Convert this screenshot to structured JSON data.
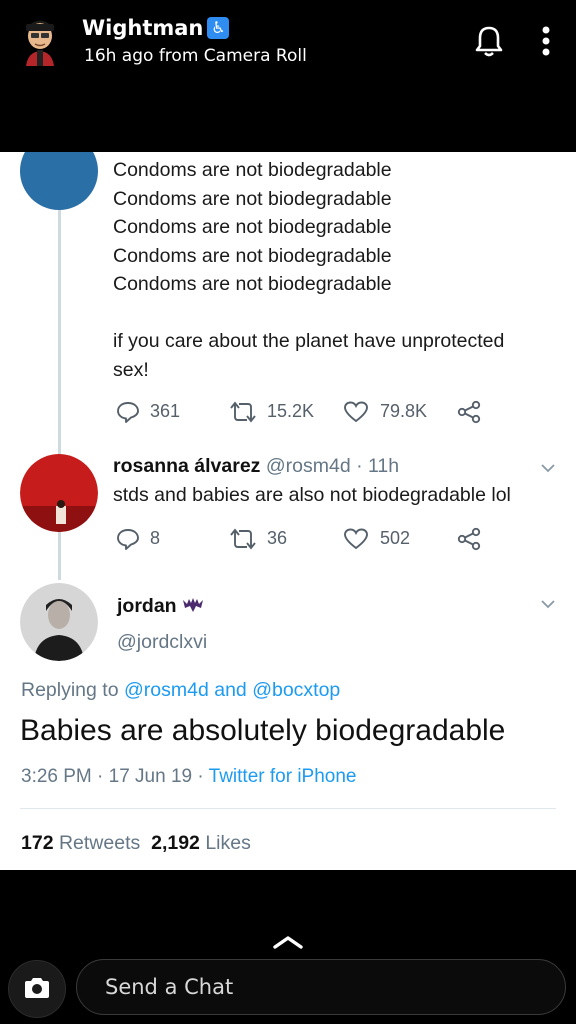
{
  "header": {
    "username": "Wightman",
    "subtitle": "16h ago from Camera Roll",
    "accessibility_icon": "wheelchair"
  },
  "tweet1": {
    "lines": [
      "Condoms are not biodegradable",
      "Condoms are not biodegradable",
      "Condoms are not biodegradable",
      "Condoms are not biodegradable",
      "Condoms are not biodegradable"
    ],
    "line6": "if you care about the planet have unprotected",
    "line7": "sex!",
    "replies": "361",
    "retweets": "15.2K",
    "likes": "79.8K"
  },
  "tweet2": {
    "name": "rosanna álvarez",
    "handle": "@rosm4d",
    "time": " · 11h",
    "text": "stds and babies are also not biodegradable lol",
    "replies": "8",
    "retweets": "36",
    "likes": "502"
  },
  "tweet3": {
    "name": "jordan",
    "handle": "@jordclxvi",
    "replying_prefix": "Replying to ",
    "replying_user1": "@rosm4d",
    "replying_and": " and ",
    "replying_user2": "@bocxtop",
    "text": "Babies are absolutely biodegradable",
    "timestamp": "3:26 PM · 17 Jun 19 · ",
    "source": "Twitter for iPhone",
    "retweet_count": "172",
    "retweet_label": " Retweets",
    "like_count": "2,192",
    "like_label": " Likes"
  },
  "footer": {
    "chat_placeholder": "Send a Chat"
  },
  "colors": {
    "twitter_blue": "#1d9bf0",
    "snap_accessibility": "#2f8cf0"
  }
}
